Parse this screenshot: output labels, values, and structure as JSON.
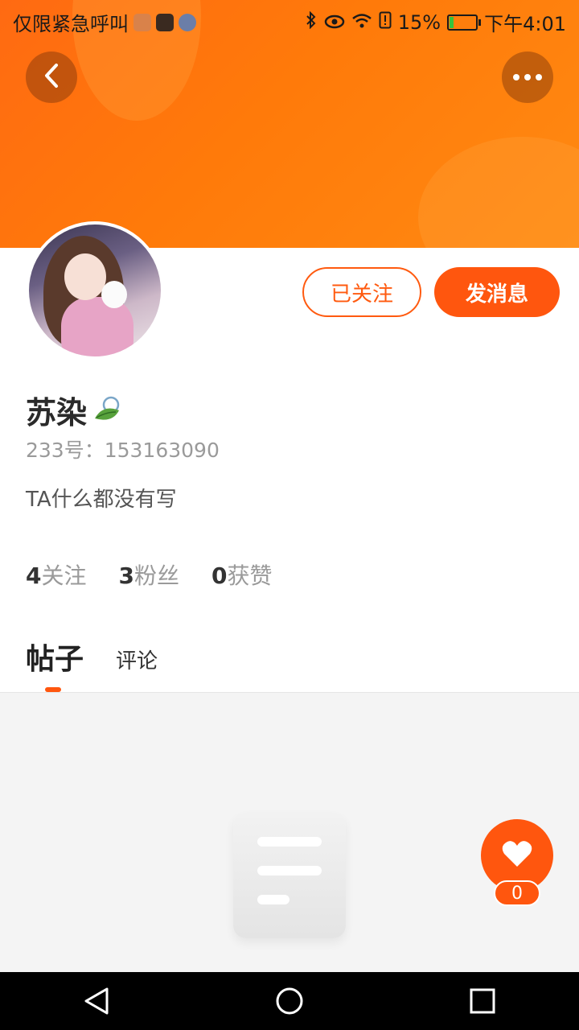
{
  "status_bar": {
    "carrier_text": "仅限紧急呼叫",
    "battery_percent": "15%",
    "time": "下午4:01",
    "icons": [
      "shield-app-icon",
      "video-app-icon",
      "browser-app-icon",
      "bluetooth-icon",
      "eye-icon",
      "wifi-icon",
      "sim-alert-icon",
      "battery-icon"
    ],
    "battery_level": 0.15
  },
  "header": {
    "back_icon": "chevron-left-icon",
    "more_icon": "more-dots-icon",
    "gradient_colors": [
      "#ff6a12",
      "#ff8a12"
    ]
  },
  "profile": {
    "name": "苏染",
    "level_icon": "leaf-level-icon",
    "id_label": "233号：153163090",
    "bio": "TA什么都没有写",
    "followed_label": "已关注",
    "message_label": "发消息"
  },
  "stats": [
    {
      "count": "4",
      "label": "关注"
    },
    {
      "count": "3",
      "label": "粉丝"
    },
    {
      "count": "0",
      "label": "获赞"
    }
  ],
  "tabs": {
    "posts": "帖子",
    "comments": "评论"
  },
  "like": {
    "count": "0",
    "icon": "heart-icon"
  },
  "accent_color": "#ff560e",
  "nav": [
    "back-triangle-icon",
    "home-circle-icon",
    "recents-square-icon"
  ]
}
